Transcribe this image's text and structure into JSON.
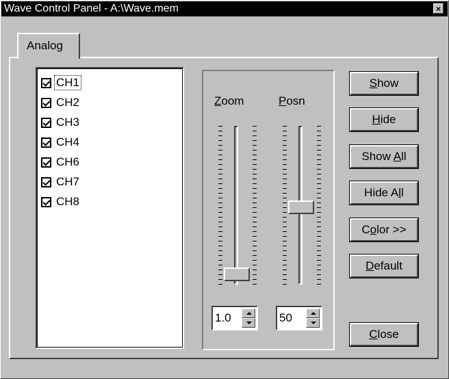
{
  "window": {
    "title": "Wave Control Panel - A:\\Wave.mem",
    "close_glyph": "×"
  },
  "tabs": [
    {
      "label": "Analog"
    }
  ],
  "channels": [
    {
      "label": "CH1",
      "checked": true
    },
    {
      "label": "CH2",
      "checked": true
    },
    {
      "label": "CH3",
      "checked": true
    },
    {
      "label": "CH4",
      "checked": true
    },
    {
      "label": "CH6",
      "checked": true
    },
    {
      "label": "CH7",
      "checked": true
    },
    {
      "label": "CH8",
      "checked": true
    }
  ],
  "zoom": {
    "label_mnemonic": "Z",
    "label_rest": "oom",
    "value": "1.0"
  },
  "posn": {
    "label_mnemonic": "P",
    "label_rest": "osn",
    "value": "50"
  },
  "buttons": {
    "show": {
      "pre": "",
      "key": "S",
      "post": "how"
    },
    "hide": {
      "pre": "",
      "key": "H",
      "post": "ide"
    },
    "show_all": {
      "pre": "Show ",
      "key": "A",
      "post": "ll"
    },
    "hide_all": {
      "pre": "Hide A",
      "key": "l",
      "post": "l"
    },
    "color": {
      "pre": "C",
      "key": "o",
      "post": "lor >>"
    },
    "default": {
      "pre": "",
      "key": "D",
      "post": "efault"
    },
    "close": {
      "pre": "",
      "key": "C",
      "post": "lose"
    }
  }
}
